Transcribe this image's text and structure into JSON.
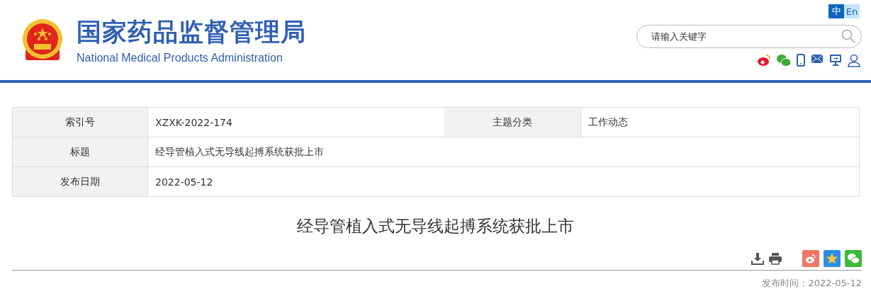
{
  "header": {
    "title": "国家药品监督管理局",
    "subtitle": "National Medical Products Administration"
  },
  "languages": [
    {
      "label": "中",
      "selected": true
    },
    {
      "label": "En",
      "selected": false
    }
  ],
  "search": {
    "placeholder": "请输入关键字"
  },
  "header_icons": [
    {
      "kind": "weibo"
    },
    {
      "kind": "wechat"
    },
    {
      "kind": "phone"
    },
    {
      "kind": "mail"
    },
    {
      "kind": "screen"
    },
    {
      "kind": "user"
    }
  ],
  "info_table": {
    "rows": [
      {
        "cells": [
          {
            "label": "索引号",
            "value": "XZXK-2022-174"
          },
          {
            "label": "主题分类",
            "value": "工作动态"
          }
        ]
      },
      {
        "cells": [
          {
            "label": "标题",
            "value": "经导管植入式无导线起搏系统获批上市"
          }
        ]
      },
      {
        "cells": [
          {
            "label": "发布日期",
            "value": "2022-05-12"
          }
        ]
      }
    ]
  },
  "article": {
    "title": "经导管植入式无导线起搏系统获批上市",
    "tools": [
      {
        "kind": "download"
      },
      {
        "kind": "print"
      }
    ],
    "share": [
      {
        "kind": "weibo"
      },
      {
        "kind": "qzone"
      },
      {
        "kind": "wechat"
      }
    ],
    "publish_label": "发布时间：",
    "publish_date": "2022-05-12"
  }
}
